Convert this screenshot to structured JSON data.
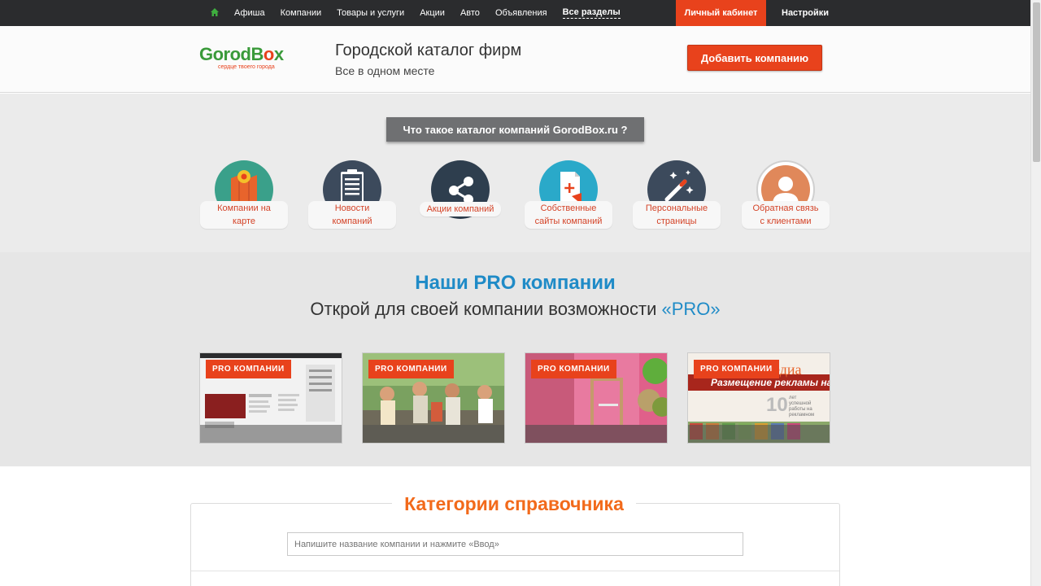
{
  "nav": {
    "items": [
      "Афиша",
      "Компании",
      "Товары и услуги",
      "Акции",
      "Авто",
      "Объявления"
    ],
    "all_sections": "Все разделы",
    "cabinet": "Личный кабинет",
    "settings": "Настройки"
  },
  "header": {
    "logo_text": "GorodBox",
    "logo_tagline": "сердце твоего города",
    "title": "Городской каталог фирм",
    "subtitle": "Все в одном месте",
    "add_button": "Добавить компанию"
  },
  "features": {
    "what_button": "Что такое каталог компаний GorodBox.ru ?",
    "items": [
      {
        "line1": "Компании на",
        "line2": "карте",
        "icon": "map-pin-icon"
      },
      {
        "line1": "Новости",
        "line2": "компаний",
        "icon": "clipboard-icon"
      },
      {
        "line1": "Акции компаний",
        "line2": "",
        "icon": "share-icon"
      },
      {
        "line1": "Собственные",
        "line2": "сайты компаний",
        "icon": "document-plus-icon"
      },
      {
        "line1": "Персональные",
        "line2": "страницы",
        "icon": "magic-wand-icon"
      },
      {
        "line1": "Обратная связь",
        "line2": "с клиентами",
        "icon": "user-icon"
      }
    ]
  },
  "pro": {
    "title": "Наши PRO компании",
    "subtitle_prefix": "Открой для своей компании возможности",
    "subtitle_highlight": "«PRO»",
    "badge": "PRO КОМПАНИИ",
    "card4_text1": "едиа",
    "card4_text2": "Размещение рекламы на",
    "card4_years": "10",
    "card4_small1": "лет",
    "card4_small2": "успешной",
    "card4_small3": "работы на рекламном"
  },
  "categories": {
    "title": "Категории справочника",
    "search_placeholder": "Напишите название компании и нажмите «Ввод»"
  },
  "colors": {
    "accent": "#e8421c",
    "blue": "#1f8bc7",
    "orange_title": "#f26a1b",
    "nav_bg": "#2b2c2e"
  }
}
